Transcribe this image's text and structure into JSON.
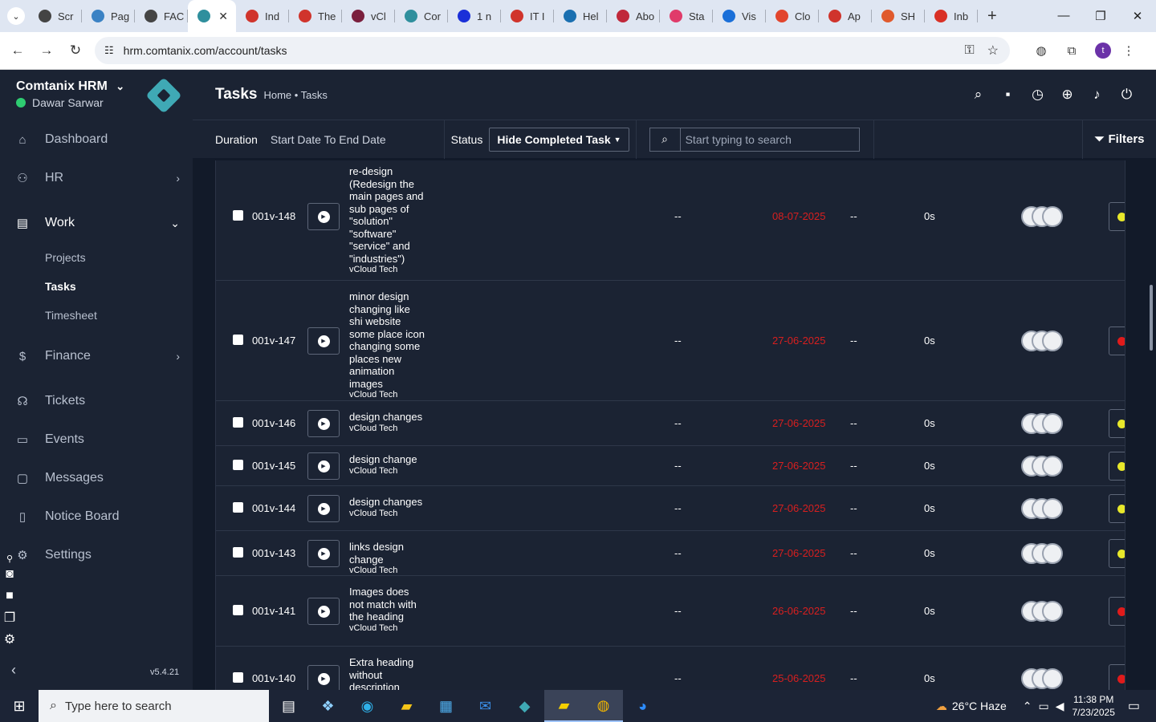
{
  "browser": {
    "tabs": [
      {
        "label": "Scr",
        "color": "#444"
      },
      {
        "label": "Pag",
        "color": "#3b82c4"
      },
      {
        "label": "FAC",
        "color": "#444"
      },
      {
        "label": "",
        "color": "#2f8f9d",
        "active": true
      },
      {
        "label": "Ind",
        "color": "#d0342c"
      },
      {
        "label": "The",
        "color": "#d0342c"
      },
      {
        "label": "vCl",
        "color": "#7a1f3d"
      },
      {
        "label": "Cor",
        "color": "#2f8f9d"
      },
      {
        "label": "1 n",
        "color": "#1a2fd8"
      },
      {
        "label": "IT I",
        "color": "#d0342c"
      },
      {
        "label": "Hel",
        "color": "#1a6fb0"
      },
      {
        "label": "Abo",
        "color": "#c0283a"
      },
      {
        "label": "Sta",
        "color": "#e03b6a"
      },
      {
        "label": "Vis",
        "color": "#1a6fd8"
      },
      {
        "label": "Clo",
        "color": "#e2452d"
      },
      {
        "label": "Ap",
        "color": "#d0342c"
      },
      {
        "label": "SH",
        "color": "#e05a2d"
      },
      {
        "label": "Inb",
        "color": "#d93025"
      }
    ],
    "url": "hrm.comtanix.com/account/tasks",
    "profile_initial": "t"
  },
  "sidebar": {
    "brand": "Comtanix HRM",
    "user": "Dawar Sarwar",
    "items": {
      "dashboard": "Dashboard",
      "hr": "HR",
      "work": "Work",
      "projects": "Projects",
      "tasks": "Tasks",
      "timesheet": "Timesheet",
      "finance": "Finance",
      "tickets": "Tickets",
      "events": "Events",
      "messages": "Messages",
      "notice_board": "Notice Board",
      "settings": "Settings"
    },
    "version": "v5.4.21"
  },
  "header": {
    "title": "Tasks",
    "breadcrumb": "Home • Tasks"
  },
  "filters": {
    "duration_label": "Duration",
    "duration_value": "Start Date To End Date",
    "status_label": "Status",
    "status_value": "Hide Completed Task",
    "search_placeholder": "Start typing to search",
    "filters_button": "Filters"
  },
  "tasks": [
    {
      "code": "001v-148",
      "title": "re-design (Redesign the main pages and sub pages of \"solution\" \"software\" \"service\" and \"industries\")",
      "company": "vCloud Tech",
      "due": "08-07-2025",
      "hours": "0s",
      "priority_color": "#e8e82a"
    },
    {
      "code": "001v-147",
      "title": "minor design changing like shi website some place icon changing some places new animation images",
      "company": "vCloud Tech",
      "due": "27-06-2025",
      "hours": "0s",
      "priority_color": "#e01b1b"
    },
    {
      "code": "001v-146",
      "title": "design changes",
      "company": "vCloud Tech",
      "due": "27-06-2025",
      "hours": "0s",
      "priority_color": "#e8e82a"
    },
    {
      "code": "001v-145",
      "title": "design change",
      "company": "vCloud Tech",
      "due": "27-06-2025",
      "hours": "0s",
      "priority_color": "#e8e82a"
    },
    {
      "code": "001v-144",
      "title": "design changes",
      "company": "vCloud Tech",
      "due": "27-06-2025",
      "hours": "0s",
      "priority_color": "#e8e82a"
    },
    {
      "code": "001v-143",
      "title": "links design change",
      "company": "vCloud Tech",
      "due": "27-06-2025",
      "hours": "0s",
      "priority_color": "#e8e82a"
    },
    {
      "code": "001v-141",
      "title": "Images does not match with the heading",
      "company": "vCloud Tech",
      "due": "26-06-2025",
      "hours": "0s",
      "priority_color": "#e01b1b"
    },
    {
      "code": "001v-140",
      "title": "Extra heading without description",
      "company": "",
      "due": "25-06-2025",
      "hours": "0s",
      "priority_color": "#e01b1b"
    }
  ],
  "empty_value": "--",
  "taskbar": {
    "search_placeholder": "Type here to search",
    "weather": "26°C  Haze",
    "time": "11:38 PM",
    "date": "7/23/2025"
  }
}
